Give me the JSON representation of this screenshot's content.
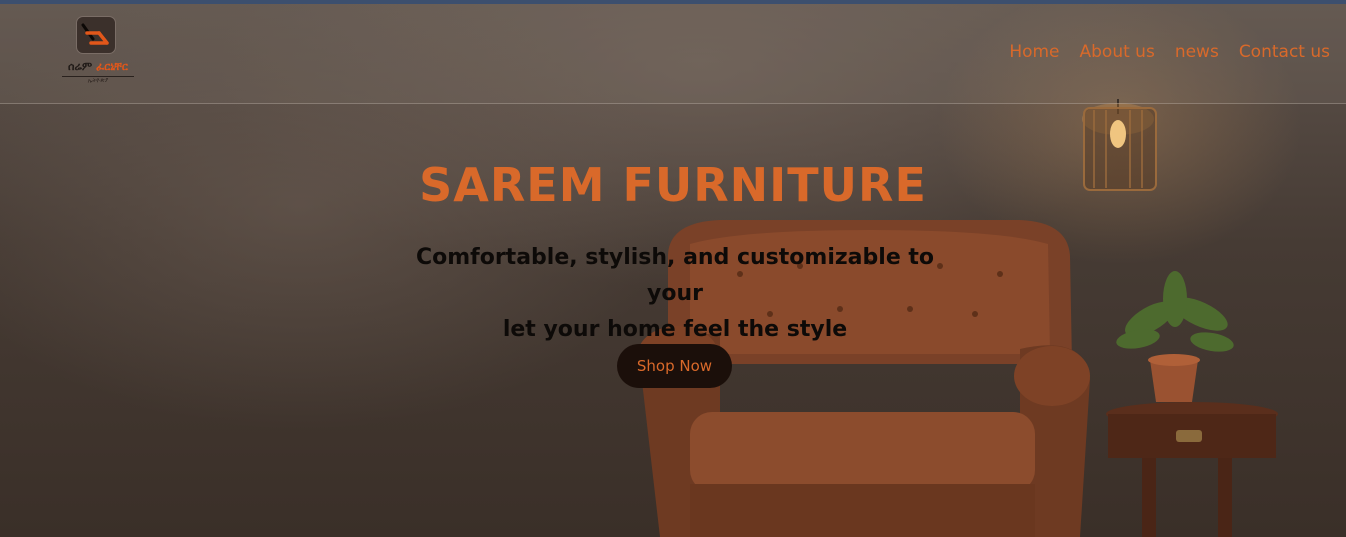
{
  "brand": {
    "name_part1": "ሰሬም",
    "name_part2": "ፈርኒቸር",
    "sub": "ኢትዮጵያ",
    "logo_icon": "armchair-logo-icon",
    "accent_color": "#d9692a"
  },
  "nav": {
    "items": [
      {
        "label": "Home"
      },
      {
        "label": "About us"
      },
      {
        "label": "news"
      },
      {
        "label": "Contact us"
      }
    ]
  },
  "hero": {
    "title": "SAREM FURNITURE",
    "tagline_line1": "Comfortable, stylish, and customizable to your",
    "tagline_line2": "let your home feel the style",
    "cta_label": "Shop Now"
  }
}
